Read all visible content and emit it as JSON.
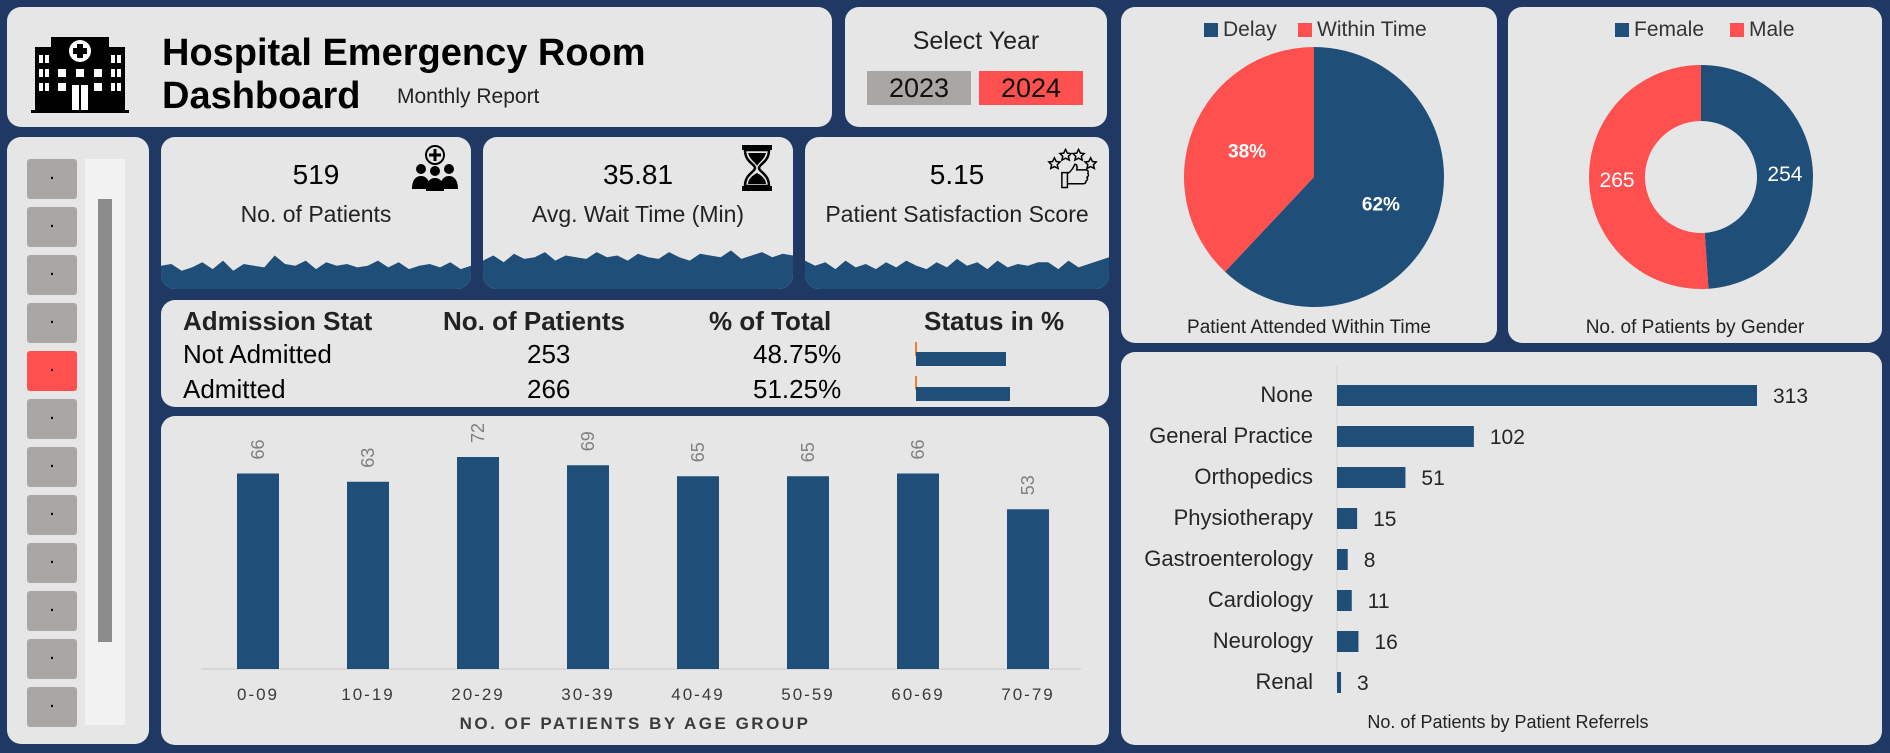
{
  "header": {
    "title": "Hospital Emergency Room Dashboard",
    "subtitle": "Monthly Report",
    "logo_icon": "hospital-building-icon"
  },
  "year_selector": {
    "label": "Select Year",
    "options": [
      "2023",
      "2024"
    ],
    "selected": "2024"
  },
  "month_slicer": {
    "items": [
      ".",
      ".",
      ".",
      ".",
      ".",
      ".",
      ".",
      ".",
      ".",
      ".",
      ".",
      "."
    ],
    "active_index": 4
  },
  "kpis": [
    {
      "value": "519",
      "label": "No. of Patients",
      "icon": "patients-group-icon",
      "trend": [
        0.45,
        0.5,
        0.3,
        0.4,
        0.55,
        0.35,
        0.6,
        0.3,
        0.5,
        0.45,
        0.4,
        0.75,
        0.5,
        0.45,
        0.6,
        0.35,
        0.55,
        0.45,
        0.5,
        0.4,
        0.45,
        0.6,
        0.4,
        0.55,
        0.35,
        0.45,
        0.5,
        0.4,
        0.55,
        0.35,
        0.45
      ]
    },
    {
      "value": "35.81",
      "label": "Avg. Wait Time (Min)",
      "icon": "hourglass-icon",
      "trend": [
        0.6,
        0.75,
        0.55,
        0.8,
        0.65,
        0.7,
        0.85,
        0.6,
        0.75,
        0.7,
        0.65,
        0.85,
        0.7,
        0.75,
        0.6,
        0.8,
        0.7,
        0.65,
        0.85,
        0.7,
        0.6,
        0.8,
        0.75,
        0.7,
        0.9,
        0.65,
        0.75,
        0.85,
        0.7,
        0.8,
        0.75
      ]
    },
    {
      "value": "5.15",
      "label": "Patient Satisfaction Score",
      "icon": "thumbs-up-stars-icon",
      "trend": [
        0.6,
        0.45,
        0.55,
        0.35,
        0.6,
        0.4,
        0.5,
        0.35,
        0.55,
        0.4,
        0.6,
        0.45,
        0.35,
        0.55,
        0.4,
        0.65,
        0.45,
        0.55,
        0.35,
        0.6,
        0.4,
        0.5,
        0.45,
        0.55,
        0.55,
        0.35,
        0.6,
        0.4,
        0.5,
        0.6,
        0.7
      ]
    }
  ],
  "admission": {
    "headers": [
      "Admission Stat",
      "No. of Patients",
      "% of Total",
      "Status in %"
    ],
    "rows": [
      {
        "status": "Not Admitted",
        "patients": "253",
        "pct": "48.75%",
        "value": 48.75
      },
      {
        "status": "Admitted",
        "patients": "266",
        "pct": "51.25%",
        "value": 51.25
      }
    ]
  },
  "colors": {
    "navy": "#1f4e79",
    "red": "#ff5050",
    "grey_button": "#aaa6a3",
    "orange_marker": "#ed7d31"
  },
  "chart_data": [
    {
      "type": "bar",
      "title": "NO. OF PATIENTS BY AGE GROUP",
      "categories": [
        "0-09",
        "10-19",
        "20-29",
        "30-39",
        "40-49",
        "50-59",
        "60-69",
        "70-79"
      ],
      "values": [
        66,
        63,
        72,
        69,
        65,
        65,
        66,
        53
      ],
      "ylim": [
        0,
        80
      ],
      "grid": false
    },
    {
      "type": "pie",
      "title": "Patient Attended Within Time",
      "categories": [
        "Delay",
        "Within Time"
      ],
      "values": [
        62,
        38
      ],
      "labels": [
        "62%",
        "38%"
      ],
      "legend": "top"
    },
    {
      "type": "pie",
      "subtype": "donut",
      "title": "No. of Patients by Gender",
      "categories": [
        "Female",
        "Male"
      ],
      "values": [
        254,
        265
      ],
      "labels": [
        "254",
        "265"
      ],
      "legend": "top"
    },
    {
      "type": "bar",
      "orientation": "horizontal",
      "title": "No. of Patients by Patient Referrels",
      "categories": [
        "None",
        "General Practice",
        "Orthopedics",
        "Physiotherapy",
        "Gastroenterology",
        "Cardiology",
        "Neurology",
        "Renal"
      ],
      "values": [
        313,
        102,
        51,
        15,
        8,
        11,
        16,
        3
      ],
      "grid": false
    }
  ]
}
